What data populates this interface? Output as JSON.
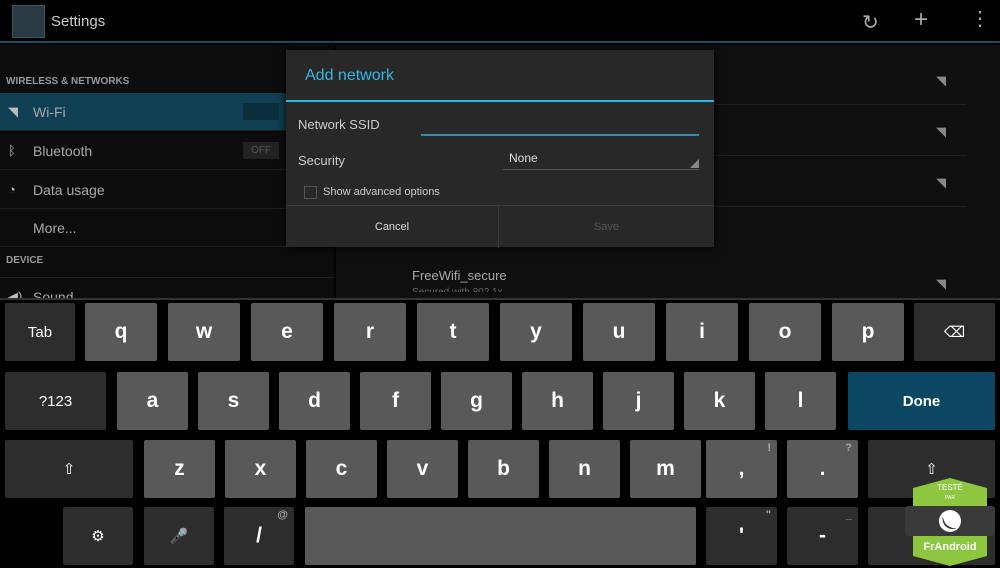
{
  "actionbar": {
    "title": "Settings",
    "icons": [
      "settings-icon",
      "sync-icon",
      "add-icon",
      "overflow-menu-icon"
    ]
  },
  "sidebar": {
    "section1": "WIRELESS & NETWORKS",
    "items": [
      {
        "label": "Wi-Fi",
        "icon": "wifi-icon",
        "toggle": ""
      },
      {
        "label": "Bluetooth",
        "icon": "bluetooth-icon",
        "toggle": "OFF"
      },
      {
        "label": "Data usage",
        "icon": "data-usage-icon"
      },
      {
        "label": "More..."
      }
    ],
    "section2": "DEVICE",
    "device_items": [
      {
        "label": "Sound",
        "icon": "sound-icon"
      }
    ]
  },
  "networks": [
    {
      "name": "",
      "secured": true
    },
    {
      "name": "",
      "secured": true
    },
    {
      "name": "",
      "secured": false
    },
    {
      "name": "FreeWifi_secure",
      "subtitle": "Secured with 802.1x",
      "secured": true
    }
  ],
  "dialog": {
    "title": "Add network",
    "ssid_label": "Network SSID",
    "ssid_value": "",
    "security_label": "Security",
    "security_value": "None",
    "advanced_label": "Show advanced options",
    "advanced_checked": false,
    "cancel": "Cancel",
    "save": "Save"
  },
  "keyboard": {
    "row1": [
      "q",
      "w",
      "e",
      "r",
      "t",
      "y",
      "u",
      "i",
      "o",
      "p"
    ],
    "row2": [
      "a",
      "s",
      "d",
      "f",
      "g",
      "h",
      "j",
      "k",
      "l"
    ],
    "row3": [
      "z",
      "x",
      "c",
      "v",
      "b",
      "n",
      "m"
    ],
    "tab": "Tab",
    "sym": "?123",
    "done": "Done",
    "comma": ",",
    "comma_hint": "!",
    "period": ".",
    "period_hint": "?",
    "slash": "/",
    "slash_hint": "@",
    "apos": "'",
    "apos_hint": "\"",
    "dash": "-",
    "dash_hint": "_",
    "smiley": ":-)"
  },
  "badge": {
    "top": "TESTÉ",
    "mid": "PAR",
    "brand": "FrAndroid",
    "color": "#8dc63f"
  },
  "colors": {
    "accent": "#33b5e5",
    "done_key": "#0b4763"
  }
}
